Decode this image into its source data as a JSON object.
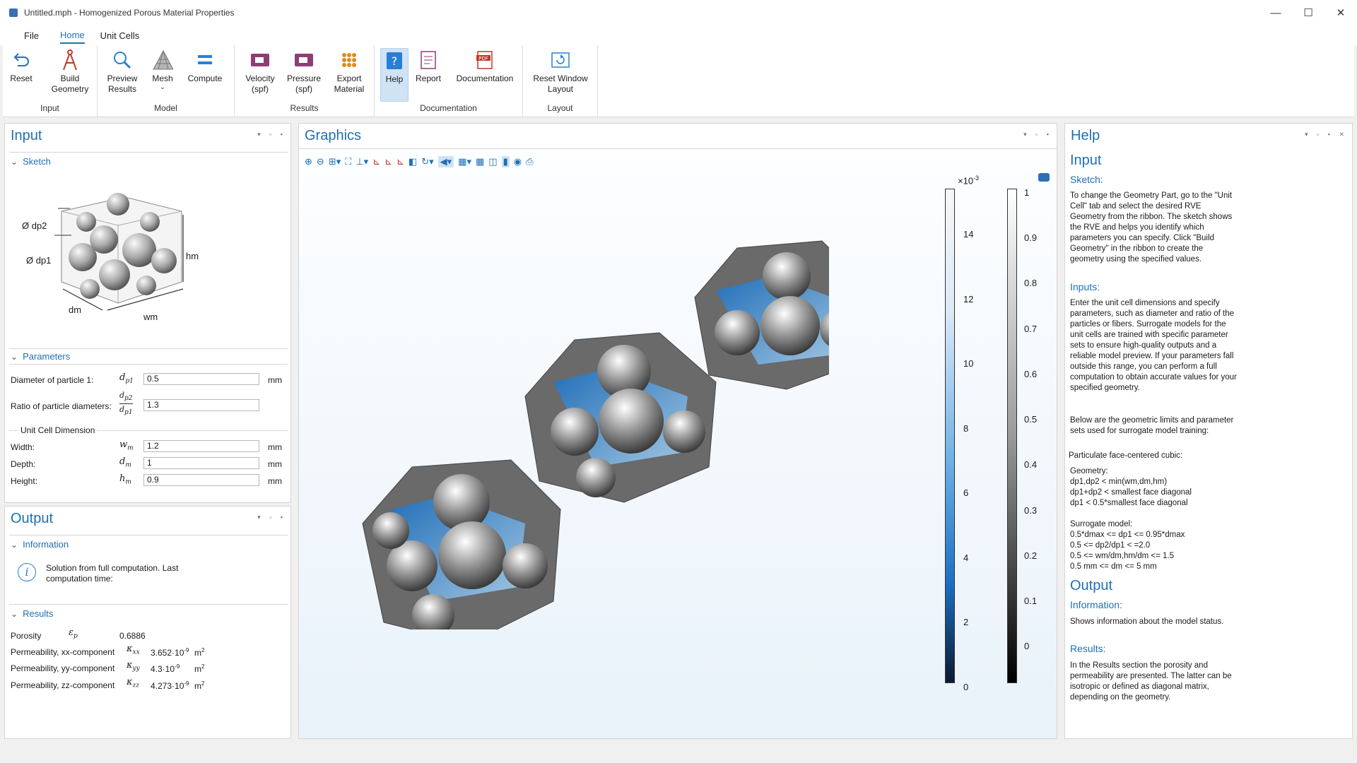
{
  "window": {
    "title": "Untitled.mph - Homogenized Porous Material Properties",
    "min": "—",
    "max": "☐",
    "close": "✕"
  },
  "menu": [
    "File",
    "Home",
    "Unit Cells"
  ],
  "ribbon": {
    "groups": {
      "input": "Input",
      "model": "Model",
      "results": "Results",
      "documentation": "Documentation",
      "layout": "Layout"
    },
    "reset": "Reset",
    "build_geometry": "Build\nGeometry",
    "preview_results": "Preview\nResults",
    "mesh": "Mesh",
    "compute": "Compute",
    "velocity": "Velocity\n(spf)",
    "pressure": "Pressure\n(spf)",
    "export_material": "Export\nMaterial",
    "help": "Help",
    "report": "Report",
    "documentation": "Documentation",
    "reset_window_layout": "Reset Window\nLayout"
  },
  "input_panel": {
    "title": "Input",
    "sketch_section": "Sketch",
    "sketch_labels": {
      "dp2": "Ø dp2",
      "dp1": "Ø dp1",
      "hm": "hm",
      "dm": "dm",
      "wm": "wm"
    },
    "parameters_section": "Parameters",
    "diameter_label": "Diameter of particle 1:",
    "diameter_value": "0.5",
    "ratio_label": "Ratio of particle diameters:",
    "ratio_value": "1.3",
    "unit_cell_dimension": "Unit Cell Dimension",
    "width_label": "Width:",
    "width_value": "1.2",
    "depth_label": "Depth:",
    "depth_value": "1",
    "height_label": "Height:",
    "height_value": "0.9",
    "unit_mm": "mm"
  },
  "output_panel": {
    "title": "Output",
    "information_section": "Information",
    "info_text": "Solution from full computation. Last computation time:",
    "results_section": "Results",
    "porosity_label": "Porosity",
    "porosity_value": "0.6886",
    "perm_xx_label": "Permeability, xx-component",
    "perm_xx_value": "3.652·10",
    "perm_yy_label": "Permeability, yy-component",
    "perm_yy_value": "4.3·10",
    "perm_zz_label": "Permeability, zz-component",
    "perm_zz_value": "4.273·10",
    "exp": "-9",
    "unit_m2": "m"
  },
  "graphics": {
    "title": "Graphics",
    "colorbar_left": {
      "scale": "×10",
      "scale_exp": "-3",
      "ticks": [
        "14",
        "12",
        "10",
        "8",
        "6",
        "4",
        "2",
        "0"
      ]
    },
    "colorbar_right": {
      "ticks": [
        "1",
        "0.9",
        "0.8",
        "0.7",
        "0.6",
        "0.5",
        "0.4",
        "0.3",
        "0.2",
        "0.1",
        "0"
      ]
    }
  },
  "help_panel": {
    "title": "Help",
    "h_input": "Input",
    "h_sketch": "Sketch:",
    "sketch_text": "To change the Geometry Part, go to the \"Unit Cell\" tab and select the desired RVE Geometry from the ribbon. The sketch shows the RVE and helps you identify which parameters you can specify. Click \"Build Geometry\" in the ribbon to create the geometry using the specified values.",
    "h_inputs": "Inputs:",
    "inputs_text": "Enter the unit cell dimensions and specify parameters, such as diameter and ratio of the particles or fibers. Surrogate models for the unit cells are trained with specific parameter sets to ensure high-quality outputs and a reliable model preview. If your parameters fall outside this range, you can perform a full computation to obtain accurate values for your specified geometry.",
    "limits_text": "Below are the geometric limits and parameter sets used for surrogate model training:",
    "pfcc": "Particulate face-centered cubic:",
    "geometry_text": "Geometry:",
    "geom_1": "dp1,dp2 < min(wm,dm,hm)",
    "geom_2": "dp1+dp2 < smallest face diagonal",
    "geom_3": "dp1 < 0.5*smallest face diagonal",
    "surrogate_text": "Surrogate model:",
    "sur_1": "0.5*dmax <= dp1 <= 0.95*dmax",
    "sur_2": "0.5 <= dp2/dp1 < =2.0",
    "sur_3": "0.5 <= wm/dm,hm/dm <= 1.5",
    "sur_4": "0.5 mm <= dm <= 5 mm",
    "h_output": "Output",
    "h_information": "Information:",
    "info_text": "Shows information about the model status.",
    "h_results": "Results:",
    "results_text": "In the Results section the porosity and permeability are presented. The latter can be isotropic or defined as diagonal matrix, depending on the geometry."
  }
}
